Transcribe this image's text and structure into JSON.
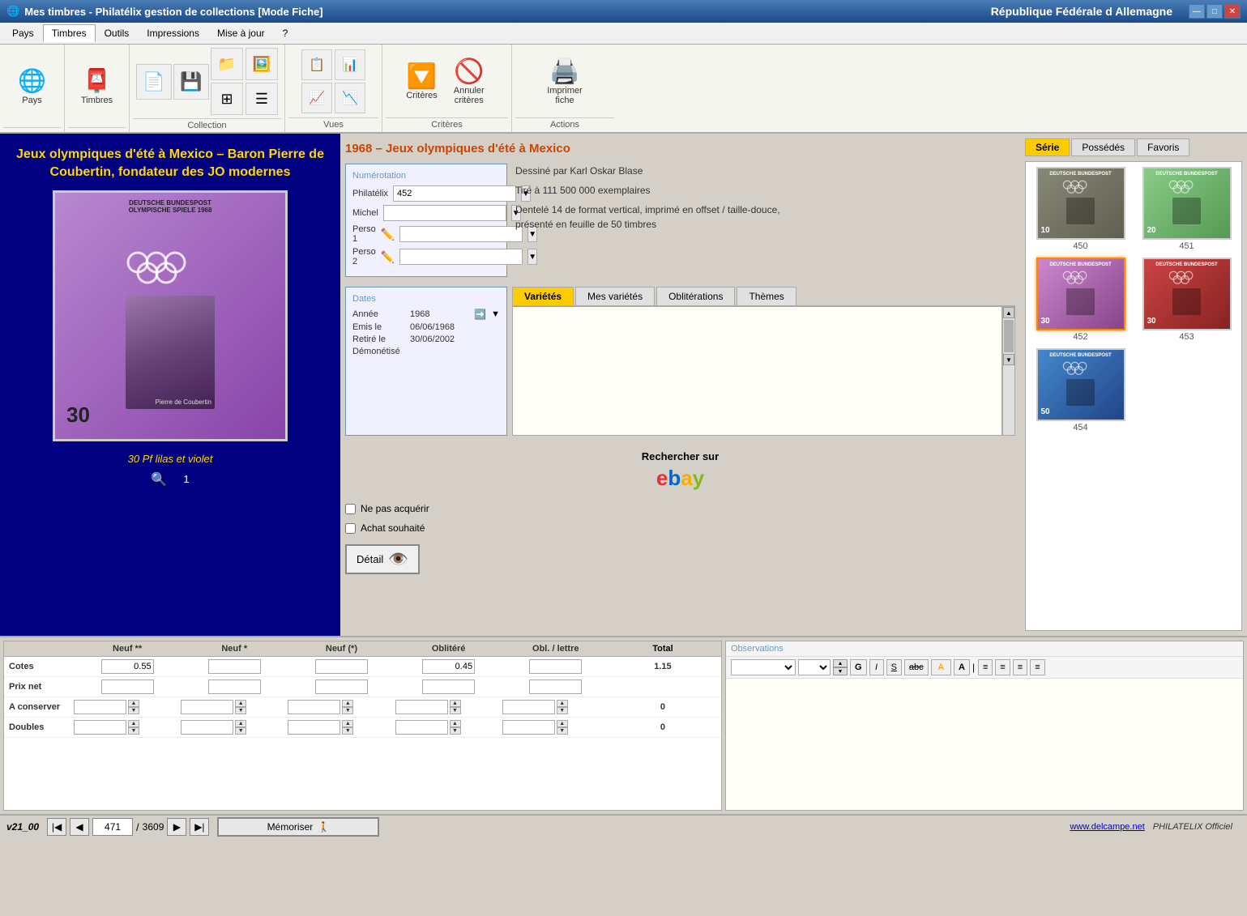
{
  "app": {
    "title": "Mes timbres - Philatélix gestion de collections [Mode Fiche]",
    "country": "République Fédérale d Allemagne",
    "logo_icon": "🌐"
  },
  "window_controls": {
    "minimize": "—",
    "maximize": "□",
    "close": "✕"
  },
  "menu": {
    "items": [
      "Pays",
      "Timbres",
      "Outils",
      "Impressions",
      "Mise à jour",
      "?"
    ],
    "active": "Timbres"
  },
  "toolbar": {
    "pays_label": "Pays",
    "timbres_label": "Timbres",
    "outils_label": "Outils",
    "impressions_label": "Impressions",
    "collection_label": "Collection",
    "vues_label": "Vues",
    "criteres_label": "Critères",
    "actions_label": "Actions",
    "criteres_btn": "Critères",
    "annuler_btn": "Annuler\ncritères",
    "imprimer_btn": "Imprimer\nfiche"
  },
  "stamp": {
    "main_title": "Jeux olympiques d'été à Mexico – Baron Pierre de Coubertin, fondateur des JO modernes",
    "series_title": "1968 – Jeux olympiques d'été à Mexico",
    "subtitle": "30 Pf lilas et violet",
    "stamp_header": "DEUTSCHE BUNDESPOST",
    "stamp_sub": "OLYMPISCHE SPIELE 1968",
    "stamp_value_text": "30",
    "stamp_num": "1"
  },
  "numeration": {
    "title": "Numérotation",
    "philatelix_label": "Philatélix",
    "philatelix_value": "452",
    "michel_label": "Michel",
    "michel_value": "",
    "perso1_label": "Perso 1",
    "perso1_value": "",
    "perso2_label": "Perso 2",
    "perso2_value": ""
  },
  "description": {
    "line1": "Dessiné par Karl Oskar Blase",
    "line2": "Tiré à 111 500 000 exemplaires",
    "line3": "Dentelé 14 de format vertical, imprimé en offset / taille-douce,",
    "line4": "présenté en feuille de 50 timbres"
  },
  "dates": {
    "title": "Dates",
    "annee_label": "Année",
    "annee_value": "1968",
    "emis_label": "Emis le",
    "emis_value": "06/06/1968",
    "retire_label": "Retiré le",
    "retire_value": "30/06/2002",
    "demonetise_label": "Démonétisé"
  },
  "tabs": {
    "items": [
      "Variétés",
      "Mes variétés",
      "Oblitérations",
      "Thèmes"
    ],
    "active": "Variétés"
  },
  "ebay": {
    "search_text": "Rechercher sur",
    "logo": "ebay"
  },
  "checkboxes": {
    "ne_pas_acquerir": "Ne pas acquérir",
    "achat_souhaite": "Achat souhaité"
  },
  "detail_btn": "Détail",
  "series_tabs": {
    "items": [
      "Série",
      "Possédés",
      "Favoris"
    ],
    "active": "Série"
  },
  "thumbnails": [
    {
      "num": "450",
      "color": "stamp-bg-450",
      "val": "10"
    },
    {
      "num": "451",
      "color": "stamp-bg-451",
      "val": "20"
    },
    {
      "num": "452",
      "color": "stamp-bg-452",
      "val": "30",
      "selected": true
    },
    {
      "num": "453",
      "color": "stamp-bg-453",
      "val": "30"
    },
    {
      "num": "454",
      "color": "stamp-bg-454",
      "val": "50"
    }
  ],
  "values": {
    "headers": [
      "",
      "Neuf **",
      "Neuf *",
      "Neuf (*)",
      "Oblitéré",
      "Obl. / lettre",
      "Total"
    ],
    "rows": [
      {
        "label": "Cotes",
        "neuf2": "0.55",
        "neuf1": "",
        "neuf0": "",
        "oblitere": "0.45",
        "obl_lettre": "",
        "total": "1.15"
      },
      {
        "label": "Prix net",
        "neuf2": "",
        "neuf1": "",
        "neuf0": "",
        "oblitere": "",
        "obl_lettre": "",
        "total": ""
      },
      {
        "label": "A conserver",
        "neuf2": "",
        "neuf1": "",
        "neuf0": "",
        "oblitere": "",
        "obl_lettre": "",
        "total": "0"
      },
      {
        "label": "Doubles",
        "neuf2": "",
        "neuf1": "",
        "neuf0": "",
        "oblitere": "",
        "obl_lettre": "",
        "total": "0"
      }
    ]
  },
  "observations": {
    "title": "Observations",
    "content": ""
  },
  "navigation": {
    "version": "v21_00",
    "current": "471",
    "total": "3609",
    "separator": "/"
  },
  "memorize_btn": "Mémoriser",
  "footer": {
    "website": "www.delcampe.net",
    "official": "PHILATELIX Officiel"
  },
  "toolbar_icons": {
    "pays_icon": "🌐",
    "timbres_icon": "📮",
    "outils_icon": "🔧",
    "impressions_icon": "🖨️",
    "new_icon": "📄",
    "save_icon": "💾",
    "folder_icon": "📁",
    "grid_icon": "⊞",
    "list_icon": "☰",
    "filter_icon": "▼",
    "cancel_icon": "✕",
    "print_icon": "🖨️"
  }
}
